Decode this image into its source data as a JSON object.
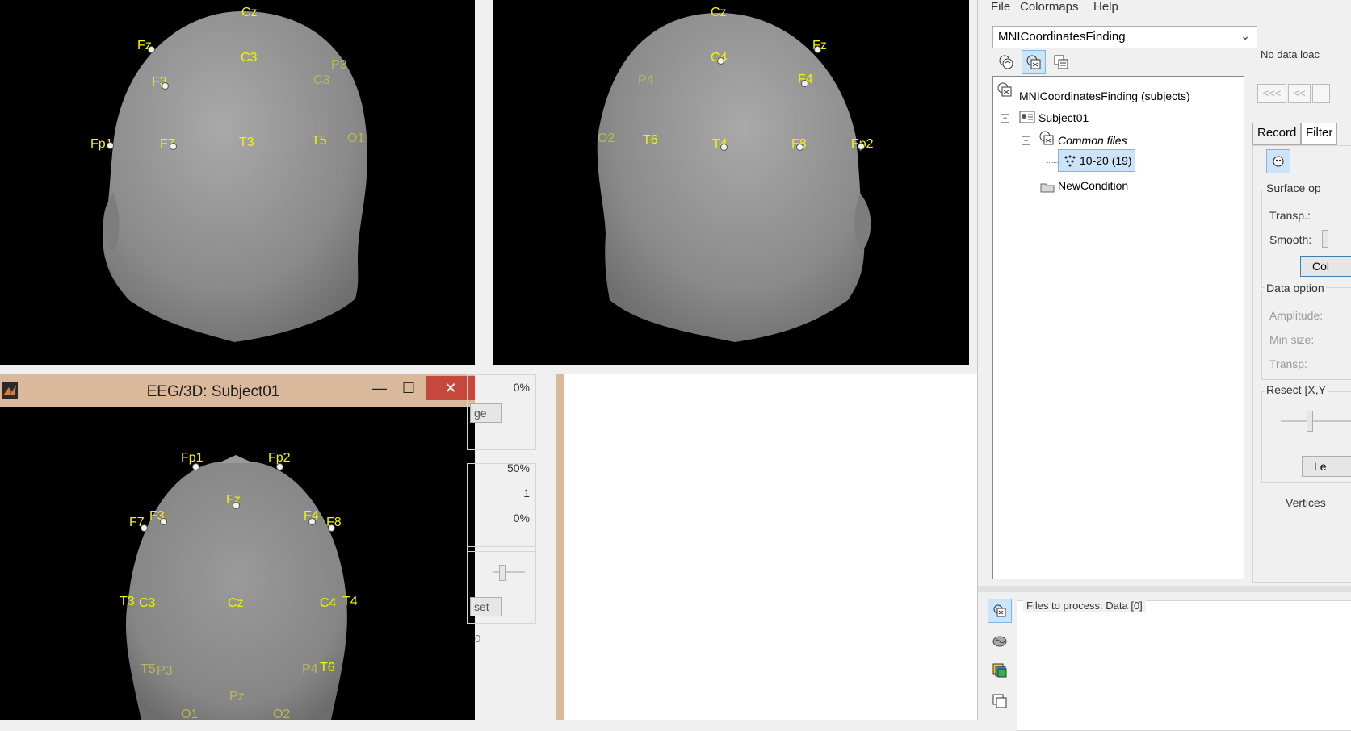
{
  "eeg_window": {
    "title": "EEG/3D: Subject01",
    "minimize_glyph": "—",
    "maximize_glyph": "☐",
    "close_glyph": "✕"
  },
  "views": {
    "left_back": [
      "Cz",
      "Fz",
      "C3",
      "F3",
      "Fp1",
      "F7",
      "T3",
      "T5",
      "O1",
      "C3",
      "P3"
    ],
    "right_back": [
      "Cz",
      "Fz",
      "C4",
      "F4",
      "F8",
      "Fp2",
      "T4",
      "T6",
      "O2",
      "P4"
    ],
    "top": [
      "Fp1",
      "Fp2",
      "Fz",
      "F7",
      "F3",
      "F4",
      "F8",
      "T3",
      "C3",
      "Cz",
      "C4",
      "T4",
      "T5",
      "P3",
      "Pz",
      "P4",
      "T6",
      "O1",
      "O2"
    ]
  },
  "middle_panel": {
    "val1": "0%",
    "btn1": "ge",
    "val2": "50%",
    "val3": "1",
    "val4": "0%",
    "btn2": "set",
    "digit": "0"
  },
  "brainstorm": {
    "menu": [
      "File",
      "Colormaps",
      "Help"
    ],
    "protocol": "MNICoordinatesFinding",
    "tree": {
      "root": "MNICoordinatesFinding (subjects)",
      "subject": "Subject01",
      "common": "Common files",
      "channel": "10-20 (19)",
      "condition": "NewCondition"
    },
    "no_data": "No data loac",
    "nav": [
      "<<<",
      "<<"
    ],
    "tabs": [
      "Record",
      "Filter"
    ],
    "surface_group": "Surface op",
    "transp": "Transp.:",
    "smooth": "Smooth:",
    "color_btn": "Col",
    "data_group": "Data option",
    "amplitude": "Amplitude:",
    "min_size": "Min size:",
    "transp2": "Transp:",
    "resect": "Resect [X,Y",
    "left_btn": "Le",
    "vertices": "Vertices",
    "files_to_process": "Files to process: Data [0]"
  },
  "colors": {
    "label_yellow": "#f4f400",
    "head_gray": "#8c8c8c",
    "title_bar": "#d9b89c",
    "close_red": "#c7473c",
    "selected": "#cce4f7"
  }
}
